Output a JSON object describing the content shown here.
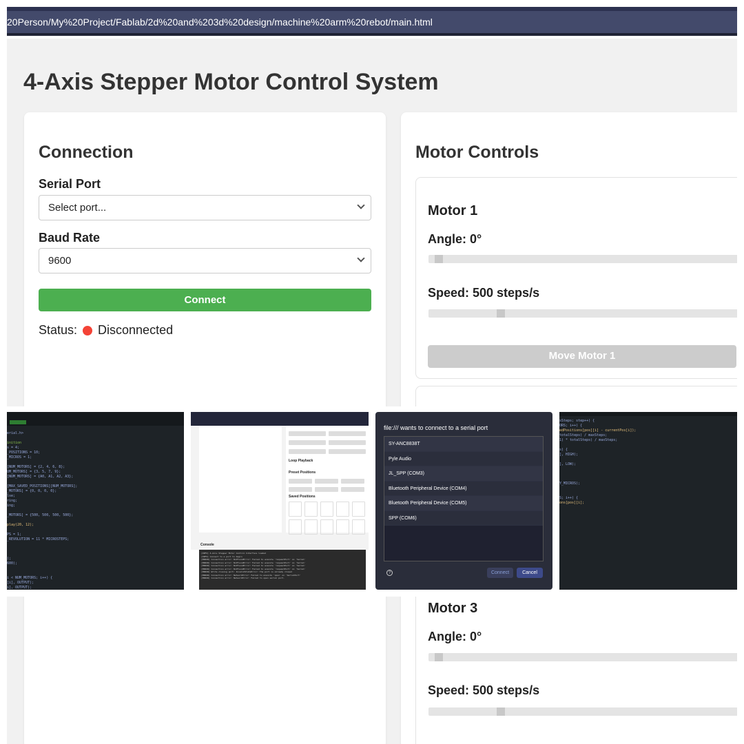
{
  "browser": {
    "url": "20Person/My%20Project/Fablab/2d%20and%203d%20design/machine%20arm%20rebot/main.html"
  },
  "page": {
    "title": "4-Axis Stepper Motor Control System"
  },
  "connection": {
    "heading": "Connection",
    "serial_port_label": "Serial Port",
    "serial_port_value": "Select port...",
    "baud_rate_label": "Baud Rate",
    "baud_rate_value": "9600",
    "connect_button": "Connect",
    "status_label": "Status:",
    "status_value": "Disconnected",
    "status_color": "#f44336"
  },
  "motor_controls": {
    "heading": "Motor Controls",
    "motors": [
      {
        "name": "Motor 1",
        "angle_label": "Angle: 0°",
        "speed_label": "Speed: 500 steps/s",
        "move_button": "Move Motor 1",
        "angle_fraction": 0.02,
        "speed_fraction": 0.22
      },
      {
        "name": "Motor 3",
        "angle_label": "Angle: 0°",
        "speed_label": "Speed: 500 steps/s",
        "angle_fraction": 0.02,
        "speed_fraction": 0.22
      }
    ]
  },
  "thumbnail_panel": {
    "loop_playback_label": "Loop Playback",
    "preset_positions_heading": "Preset Positions",
    "saved_positions_heading": "Saved Positions",
    "console_heading": "Console"
  },
  "serial_dialog": {
    "title": "file:/// wants to connect to a serial port",
    "ports": [
      "SY-ANC8838T",
      "Pyle Audio",
      "JL_SPP (COM3)",
      "Bluetooth Peripheral Device (COM4)",
      "Bluetooth Peripheral Device (COM5)",
      "SPP (COM6)"
    ],
    "connect_button": "Connect",
    "cancel_button": "Cancel"
  },
  "colors": {
    "connect_green": "#4caf50",
    "disabled_gray": "#cccccc",
    "browser_bar": "#434a6b"
  }
}
